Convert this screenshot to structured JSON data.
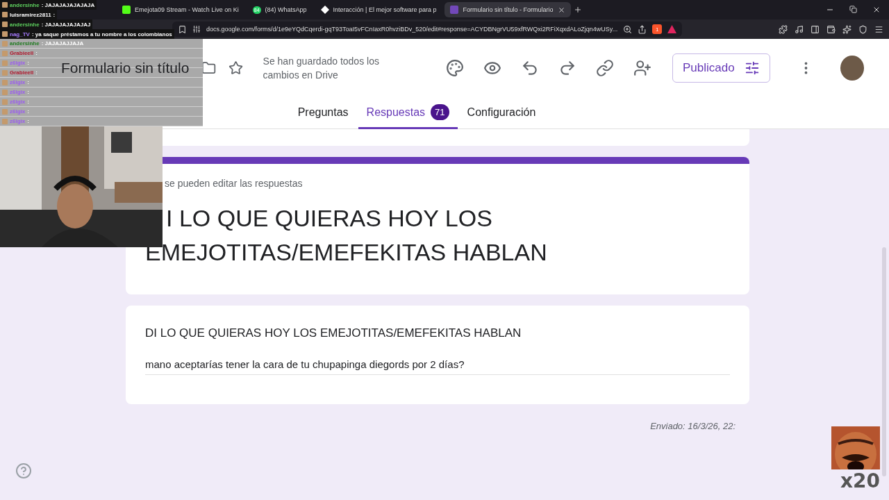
{
  "browser": {
    "tabs": [
      {
        "title": "Emejota09 Stream - Watch Live on Ki",
        "kind": "kick",
        "selected": false
      },
      {
        "title": "(84) WhatsApp",
        "kind": "whatsapp",
        "badge": "84",
        "selected": false
      },
      {
        "title": "Interacción | El mejor software para p",
        "kind": "diamond",
        "selected": false
      },
      {
        "title": "Formulario sin título - Formulario",
        "kind": "forms",
        "selected": true
      }
    ],
    "url": "docs.google.com/forms/d/1e9eYQdCqerdi-gqT93ToaI5vFCnIaxR0hvziBDv_520/edit#response=ACYDBNgrVU59xfRWQxi2RFiXqxdALoZjqn4wUSy...",
    "shield_count": "1"
  },
  "header": {
    "title": "Formulario sin título",
    "save_status": "Se han guardado todos los cambios en Drive",
    "publish_button": "Publicado"
  },
  "form_tabs": [
    {
      "label": "Preguntas",
      "selected": false
    },
    {
      "label": "Respuestas",
      "count": "71",
      "selected": true
    },
    {
      "label": "Configuración",
      "selected": false
    }
  ],
  "form_card": {
    "notice": "se pueden editar las respuestas",
    "title": "I LO QUE QUIERAS HOY LOS EMEJOTITAS/EMEFEKITAS HABLAN"
  },
  "response": {
    "question": "DI LO QUE QUIERAS HOY LOS EMEJOTITAS/EMEFEKITAS HABLAN",
    "answer": "mano aceptarías tener la cara de tu chupapinga diegords por 2 días?"
  },
  "sent": {
    "label": "Enviado: 16/3/26, 22:"
  },
  "chat": [
    {
      "user": "andersinhe",
      "message": ": JAJAJAJAJAJAJA",
      "color": "#5fd35f",
      "kind": "dark"
    },
    {
      "user": "luisramirez2811",
      "message": ":",
      "color": "#ffffff",
      "kind": "dark"
    },
    {
      "user": "andersinhe",
      "message": ": JAJAJAJAJAJAJ",
      "color": "#5fd35f",
      "kind": "dark"
    },
    {
      "user": "nag_TV",
      "message": ": ya saque préstamos a tu nombre a los colombianos",
      "color": "#a77bff",
      "kind": "dark"
    },
    {
      "user": "andersinhe",
      "message": ": JAJAJAJJAJA",
      "color": "#1f7a1f",
      "kind": "grey"
    },
    {
      "user": "Grabieell",
      "message": ":",
      "color": "#b0182c",
      "kind": "grey"
    },
    {
      "user": "z6lgix",
      "message": ":",
      "color": "#9b5cf0",
      "kind": "grey"
    },
    {
      "user": "Grabieell",
      "message": ":",
      "color": "#b0182c",
      "kind": "grey"
    },
    {
      "user": "z6lgix",
      "message": ":",
      "color": "#9b5cf0",
      "kind": "grey"
    },
    {
      "user": "z6lgix",
      "message": ":",
      "color": "#9b5cf0",
      "kind": "grey"
    },
    {
      "user": "z6lgix",
      "message": ":",
      "color": "#9b5cf0",
      "kind": "grey"
    },
    {
      "user": "z6lgix",
      "message": ":",
      "color": "#9b5cf0",
      "kind": "grey"
    },
    {
      "user": "z6lgix",
      "message": ":",
      "color": "#9b5cf0",
      "kind": "grey"
    }
  ],
  "emote": {
    "multiplier": "x20"
  }
}
